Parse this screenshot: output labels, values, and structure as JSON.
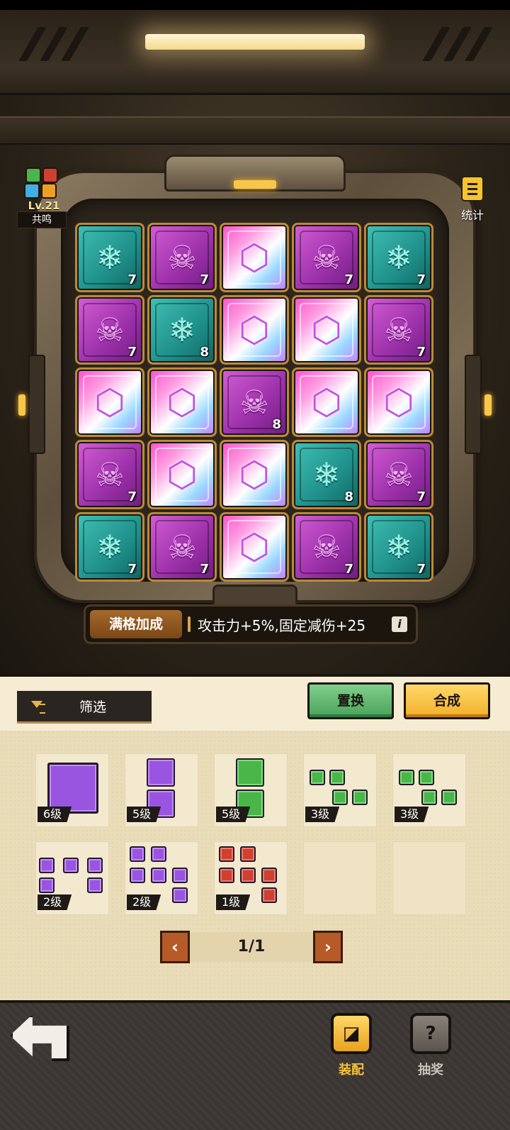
{
  "resonance": {
    "level": "Lv.21",
    "label": "共鸣"
  },
  "stats": {
    "label": "统计",
    "icon": "notepad-icon"
  },
  "board": {
    "rows": [
      [
        {
          "type": "snow",
          "level": "7"
        },
        {
          "type": "skull",
          "level": "7"
        },
        {
          "type": "gem",
          "level": ""
        },
        {
          "type": "skull",
          "level": "7"
        },
        {
          "type": "snow",
          "level": "7"
        }
      ],
      [
        {
          "type": "skull",
          "level": "7"
        },
        {
          "type": "snow",
          "level": "8"
        },
        {
          "type": "gem",
          "level": ""
        },
        {
          "type": "gem",
          "level": ""
        },
        {
          "type": "skull",
          "level": "7"
        }
      ],
      [
        {
          "type": "gem",
          "level": ""
        },
        {
          "type": "gem",
          "level": ""
        },
        {
          "type": "skull",
          "level": "8"
        },
        {
          "type": "gem",
          "level": ""
        },
        {
          "type": "gem",
          "level": ""
        }
      ],
      [
        {
          "type": "skull",
          "level": "7"
        },
        {
          "type": "gem",
          "level": ""
        },
        {
          "type": "gem",
          "level": ""
        },
        {
          "type": "snow",
          "level": "8"
        },
        {
          "type": "skull",
          "level": "7"
        }
      ],
      [
        {
          "type": "snow",
          "level": "7"
        },
        {
          "type": "skull",
          "level": "7"
        },
        {
          "type": "gem",
          "level": ""
        },
        {
          "type": "skull",
          "level": "7"
        },
        {
          "type": "snow",
          "level": "7"
        }
      ]
    ]
  },
  "bonus": {
    "tag": "满格加成",
    "text": "攻击力+5%,固定减伤+25",
    "info": "i"
  },
  "toolbar": {
    "filter_label": "筛选",
    "swap_label": "置换",
    "merge_label": "合成"
  },
  "inventory": [
    {
      "level": "6级",
      "color": "purple",
      "shape": "single-big"
    },
    {
      "level": "5级",
      "color": "purple",
      "shape": "vertical-2"
    },
    {
      "level": "5级",
      "color": "green",
      "shape": "vertical-2"
    },
    {
      "level": "3级",
      "color": "green",
      "shape": "z-4"
    },
    {
      "level": "3级",
      "color": "green",
      "shape": "z-4"
    },
    {
      "level": "2级",
      "color": "purple",
      "shape": "l-5"
    },
    {
      "level": "2级",
      "color": "purple",
      "shape": "t-6"
    },
    {
      "level": "1级",
      "color": "red",
      "shape": "t-6"
    },
    {
      "level": "",
      "color": "",
      "shape": "empty"
    },
    {
      "level": "",
      "color": "",
      "shape": "empty"
    }
  ],
  "pager": {
    "text": "1/1",
    "prev": "‹",
    "next": "›"
  },
  "footer": {
    "back_icon": "back-arrow-icon",
    "equip_label": "装配",
    "draw_label": "抽奖"
  },
  "colors": {
    "skull": "#b53fc2",
    "snow": "#23a39b",
    "gem": "#ff6fd6",
    "accent": "#f2b02a",
    "swap": "#4aa35a"
  }
}
